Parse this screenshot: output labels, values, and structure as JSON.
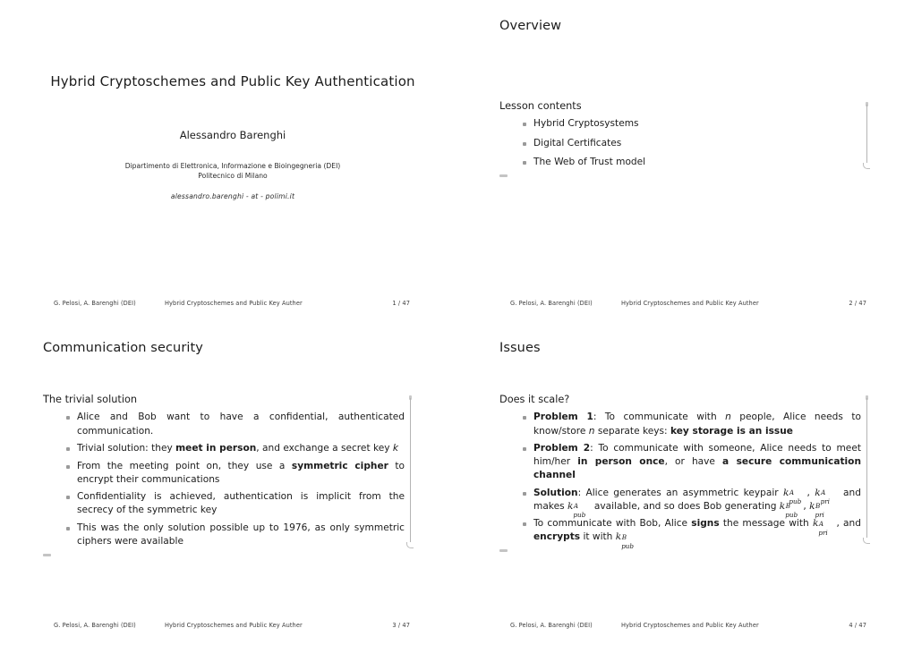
{
  "document": {
    "title": "Hybrid Cryptoschemes and Public Key Authentication",
    "author": "Alessandro Barenghi",
    "institute_line1": "Dipartimento di Elettronica, Informazione e Bioingegneria (DEI)",
    "institute_line2": "Politecnico di Milano",
    "email": "alessandro.barenghi - at - polimi.it"
  },
  "footer": {
    "authors": "G. Pelosi, A. Barenghi  (DEI)",
    "short_title": "Hybrid Cryptoschemes and Public Key Auther",
    "pages": [
      "1 / 47",
      "2 / 47",
      "3 / 47",
      "4 / 47"
    ]
  },
  "slides": [
    {
      "id": "title-slide",
      "kind": "title"
    },
    {
      "id": "overview-slide",
      "kind": "content",
      "frame_title": "Overview",
      "block_title": "Lesson contents",
      "items": [
        "Hybrid Cryptosystems",
        "Digital Certificates",
        "The Web of Trust model"
      ]
    },
    {
      "id": "communication-security-slide",
      "kind": "content",
      "frame_title": "Communication security",
      "block_title": "The trivial solution",
      "items_html": [
        "Alice and Bob want to have a confidential, authenticated communication.",
        "Trivial solution: they <b>meet in person</b>, and exchange a secret key <i>k</i>",
        "From the meeting point on, they use a <b>symmetric cipher</b> to encrypt their communications",
        "Confidentiality is achieved, authentication is implicit from the secrecy of the symmetric key",
        "This was the only solution possible up to 1976, as only symmetric ciphers were available"
      ]
    },
    {
      "id": "issues-slide",
      "kind": "content",
      "frame_title": "Issues",
      "block_title": "Does it scale?",
      "items_html": [
        "<b>Problem 1</b>: To communicate with <i>n</i> people, Alice needs to know/store <i>n</i> separate keys: <b>key storage is an issue</b>",
        "<b>Problem 2</b>: To communicate with someone, Alice needs to meet him/her <b>in person once</b>, or have <b>a secure communication channel</b>",
        "<b>Solution</b>: Alice generates an asymmetric keypair <span class=\"ksym\"><span class=\"base\">k</span><span class=\"scripts\"><span class=\"sup\">A</span><span class=\"sub\">pub</span></span></span>, <span class=\"ksym\"><span class=\"base\">k</span><span class=\"scripts\"><span class=\"sup\">A</span><span class=\"sub\">pri</span></span></span> and makes <span class=\"ksym\"><span class=\"base\">k</span><span class=\"scripts\"><span class=\"sup\">A</span><span class=\"sub\">pub</span></span></span> available, and so does Bob generating <span class=\"ksym\"><span class=\"base\">k</span><span class=\"scripts\"><span class=\"sup\">B</span><span class=\"sub\">pub</span></span></span>, <span class=\"ksym\"><span class=\"base\">k</span><span class=\"scripts\"><span class=\"sup\">B</span><span class=\"sub\">pri</span></span></span>",
        "To communicate with Bob, Alice <b>signs</b> the message with <span class=\"ksym\"><span class=\"base\">k</span><span class=\"scripts\"><span class=\"sup\">A</span><span class=\"sub\">pri</span></span></span>, and <b>encrypts</b> it with <span class=\"ksym\"><span class=\"base\">k</span><span class=\"scripts\"><span class=\"sup\">B</span><span class=\"sub\">pub</span></span></span>"
      ]
    }
  ],
  "colors": {
    "background": "#ffffff",
    "text": "#1c1c1c",
    "bullet": "#9a9a9a",
    "rule": "#b4b4b4",
    "footer_text": "#3b3b3b"
  }
}
